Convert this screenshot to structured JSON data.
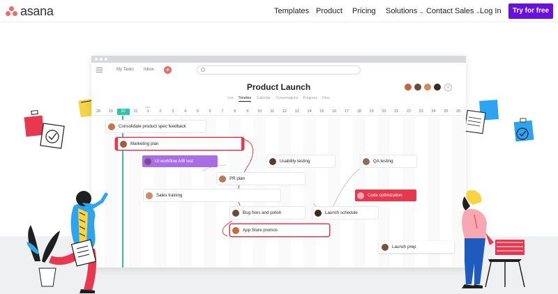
{
  "brand": {
    "name": "asana",
    "accent": "#690fdf",
    "coral": "#f06a6a"
  },
  "nav": {
    "items": [
      {
        "label": "Templates"
      },
      {
        "label": "Product"
      },
      {
        "label": "Pricing"
      },
      {
        "label": "Solutions",
        "dropdown": true
      },
      {
        "label": "Contact Sales",
        "dropdown": true
      },
      {
        "label": "Log In"
      }
    ],
    "cta": "Try for free"
  },
  "app": {
    "top_links": [
      "My Tasks",
      "Inbox"
    ],
    "title": "Product Launch",
    "tabs": [
      {
        "label": "List"
      },
      {
        "label": "Timeline",
        "active": true
      },
      {
        "label": "Calendar"
      },
      {
        "label": "Conversations"
      },
      {
        "label": "Progress"
      },
      {
        "label": "Files"
      }
    ],
    "month": "Sep",
    "dates": [
      "28",
      "29",
      "30",
      "31",
      "1",
      "2",
      "3",
      "4",
      "5",
      "6",
      "7",
      "8",
      "9",
      "10",
      "11",
      "12",
      "13",
      "14",
      "15",
      "16",
      "17",
      "18",
      "19",
      "20",
      "21",
      "22",
      "23",
      "24",
      "25",
      "26"
    ],
    "today": "30",
    "tasks": [
      {
        "name": "Consolidate product spec feedback"
      },
      {
        "name": "Marketing plan",
        "selected": true
      },
      {
        "name": "UI workflow A/B test"
      },
      {
        "name": "Usability testing"
      },
      {
        "name": "QA testing"
      },
      {
        "name": "PR plan"
      },
      {
        "name": "Sales training"
      },
      {
        "name": "Code optimization"
      },
      {
        "name": "Bug fixes and polish"
      },
      {
        "name": "Launch schedule"
      },
      {
        "name": "App Store promos"
      }
    ]
  },
  "floating_task": {
    "name": "Launch prep"
  },
  "colors": {
    "today": "#2ec4a6",
    "purple_task": "#a86ee6",
    "red_task": "#e8384f"
  }
}
